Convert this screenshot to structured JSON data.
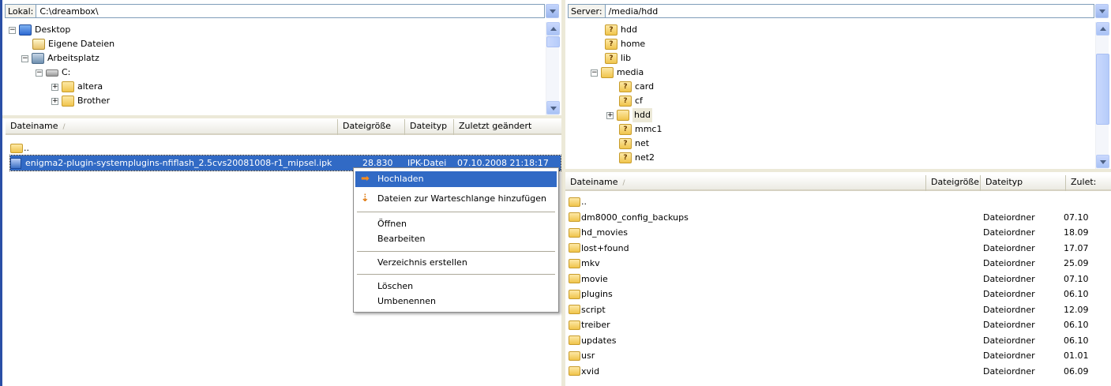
{
  "local": {
    "path_label": "Lokal:",
    "path_value": "C:\\dreambox\\",
    "tree": [
      {
        "label": "Desktop",
        "exp": "−",
        "icon": "desktop-icon"
      },
      {
        "label": "Eigene Dateien",
        "exp": "",
        "icon": "documents-folder-icon"
      },
      {
        "label": "Arbeitsplatz",
        "exp": "−",
        "icon": "computer-icon"
      },
      {
        "label": "C:",
        "exp": "−",
        "icon": "drive-icon"
      },
      {
        "label": "altera",
        "exp": "+",
        "icon": "folder-icon"
      },
      {
        "label": "Brother",
        "exp": "+",
        "icon": "folder-icon"
      }
    ],
    "columns": [
      "Dateiname",
      "Dateigröße",
      "Dateityp",
      "Zuletzt geändert"
    ],
    "sort_indicator": "/",
    "files": [
      {
        "name": "..",
        "size": "",
        "type": "",
        "modified": ""
      },
      {
        "name": "enigma2-plugin-systemplugins-nfiflash_2.5cvs20081008-r1_mipsel.ipk",
        "size": "28.830",
        "type": "IPK-Datei",
        "modified": "07.10.2008 21:18:17"
      }
    ]
  },
  "remote": {
    "path_label": "Server:",
    "path_value": "/media/hdd",
    "tree": [
      {
        "label": "hdd",
        "exp": "",
        "icon": "unknown-folder-icon"
      },
      {
        "label": "home",
        "exp": "",
        "icon": "unknown-folder-icon"
      },
      {
        "label": "lib",
        "exp": "",
        "icon": "unknown-folder-icon"
      },
      {
        "label": "media",
        "exp": "−",
        "icon": "folder-icon"
      },
      {
        "label": "card",
        "exp": "",
        "icon": "unknown-folder-icon"
      },
      {
        "label": "cf",
        "exp": "",
        "icon": "unknown-folder-icon"
      },
      {
        "label": "hdd",
        "exp": "+",
        "icon": "folder-icon"
      },
      {
        "label": "mmc1",
        "exp": "",
        "icon": "unknown-folder-icon"
      },
      {
        "label": "net",
        "exp": "",
        "icon": "unknown-folder-icon"
      },
      {
        "label": "net2",
        "exp": "",
        "icon": "unknown-folder-icon"
      }
    ],
    "columns": [
      "Dateiname",
      "Dateigröße",
      "Dateityp",
      "Zulet:"
    ],
    "sort_indicator": "/",
    "files": [
      {
        "name": "..",
        "type": "",
        "modified": ""
      },
      {
        "name": "dm8000_config_backups",
        "type": "Dateiordner",
        "modified": "07.10"
      },
      {
        "name": "hd_movies",
        "type": "Dateiordner",
        "modified": "18.09"
      },
      {
        "name": "lost+found",
        "type": "Dateiordner",
        "modified": "17.07"
      },
      {
        "name": "mkv",
        "type": "Dateiordner",
        "modified": "25.09"
      },
      {
        "name": "movie",
        "type": "Dateiordner",
        "modified": "07.10"
      },
      {
        "name": "plugins",
        "type": "Dateiordner",
        "modified": "06.10"
      },
      {
        "name": "script",
        "type": "Dateiordner",
        "modified": "12.09"
      },
      {
        "name": "treiber",
        "type": "Dateiordner",
        "modified": "06.10"
      },
      {
        "name": "updates",
        "type": "Dateiordner",
        "modified": "06.10"
      },
      {
        "name": "usr",
        "type": "Dateiordner",
        "modified": "01.01"
      },
      {
        "name": "xvid",
        "type": "Dateiordner",
        "modified": "06.09"
      }
    ]
  },
  "context_menu": {
    "upload": "Hochladen",
    "queue": "Dateien zur Warteschlange hinzufügen",
    "open": "Öffnen",
    "edit": "Bearbeiten",
    "mkdir": "Verzeichnis erstellen",
    "delete": "Löschen",
    "rename": "Umbenennen",
    "upload_icon": "➡",
    "queue_icon": "⇣"
  },
  "colors": {
    "selection": "#316ac5",
    "pane_border": "#2a4fa6"
  }
}
